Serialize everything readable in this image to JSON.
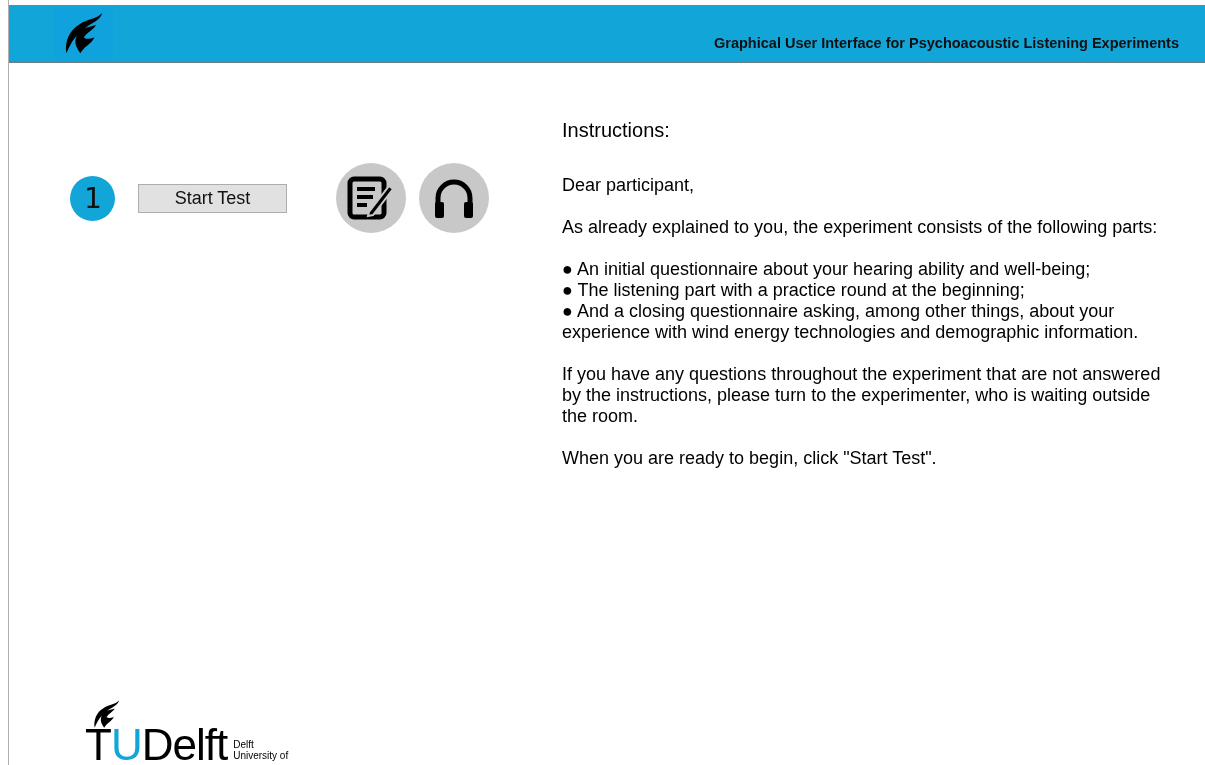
{
  "header": {
    "title": "Graphical User Interface for Psychoacoustic Listening Experiments"
  },
  "steps": [
    {
      "number": "1",
      "button": "Start Test"
    }
  ],
  "instructions": {
    "heading": "Instructions:",
    "blocks": [
      {
        "kind": "text",
        "text": "Dear participant,"
      },
      {
        "kind": "text",
        "text": "As already explained to you, the experiment consists of the following parts:"
      },
      {
        "kind": "list",
        "items": [
          "● An initial questionnaire about your hearing ability and well-being;",
          "● The listening part with a practice round at the beginning;",
          "● And a closing questionnaire asking, among other things, about your experience with wind energy technologies and demographic information."
        ]
      },
      {
        "kind": "text",
        "text": "If you have any questions throughout the experiment that are not answered by the instructions, please turn to the experimenter, who is waiting outside the room."
      },
      {
        "kind": "text",
        "text": "When you are ready to begin, click \"Start Test\"."
      }
    ]
  },
  "footer_logo": {
    "letter_1": "T",
    "letter_2": "U",
    "word": "Delft",
    "caption": [
      "Delft",
      "University of"
    ]
  }
}
